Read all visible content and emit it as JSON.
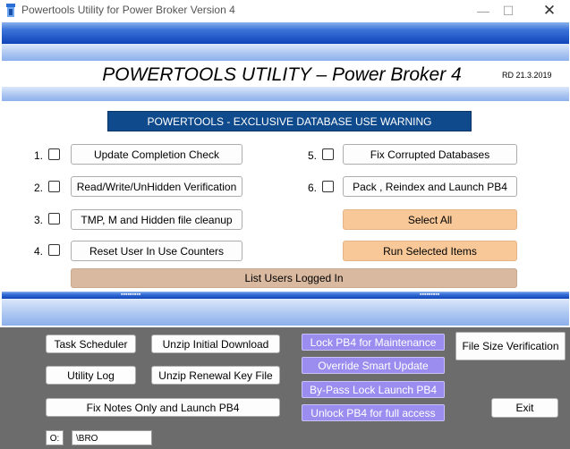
{
  "window": {
    "title": "Powertools Utility for Power Broker Version 4",
    "minimize": "—",
    "maximize": "☐",
    "close": "✕"
  },
  "header": {
    "title": "POWERTOOLS UTILITY – Power Broker 4",
    "version": "RD  21.3.2019"
  },
  "warning": "POWERTOOLS - EXCLUSIVE DATABASE USE WARNING",
  "options": {
    "left": [
      {
        "num": "1.",
        "label": "Update Completion Check"
      },
      {
        "num": "2.",
        "label": "Read/Write/UnHidden Verification"
      },
      {
        "num": "3.",
        "label": "TMP, M and Hidden file cleanup"
      },
      {
        "num": "4.",
        "label": "Reset User In Use Counters"
      }
    ],
    "right": [
      {
        "num": "5.",
        "label": "Fix Corrupted Databases"
      },
      {
        "num": "6.",
        "label": "Pack , Reindex and Launch PB4"
      }
    ]
  },
  "actions": {
    "select_all": "Select All",
    "run_selected": "Run Selected Items",
    "list_users": "List Users Logged In"
  },
  "grip_marks": "▪▪▪▪▪▪▪▪▪",
  "bottom": {
    "task_scheduler": "Task Scheduler",
    "unzip_initial": "Unzip Initial Download",
    "utility_log": "Utility Log",
    "unzip_renewal": "Unzip Renewal Key File",
    "fix_notes": "Fix Notes Only and Launch PB4",
    "lock_pb4": "Lock PB4 for Maintenance",
    "override_update": "Override Smart Update",
    "bypass_lock": "By-Pass Lock Launch PB4",
    "unlock_pb4": "Unlock PB4 for full access",
    "file_size": "File Size Verification",
    "exit": "Exit"
  },
  "status": {
    "drive": "O:",
    "path": "\\BRO"
  },
  "colors": {
    "band_blue": "#1a4fbf",
    "warning_bg": "#0f4a8c",
    "orange_button": "#f8c898",
    "tan_button": "#d9b99f",
    "purple_button": "#9b8cef",
    "bottom_panel": "#6c6c6c"
  }
}
